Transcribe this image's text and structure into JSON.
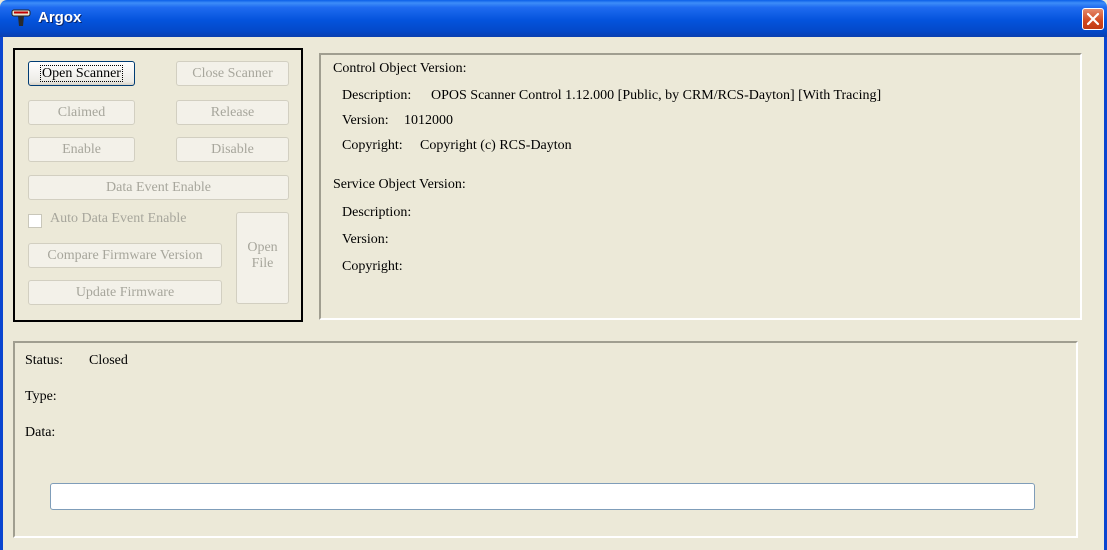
{
  "window": {
    "title": "Argox",
    "app_icon": "scanner-app-icon",
    "close_icon": "close-icon"
  },
  "controls": {
    "open_scanner": "Open Scanner",
    "close_scanner": "Close Scanner",
    "claimed": "Claimed",
    "release": "Release",
    "enable": "Enable",
    "disable": "Disable",
    "data_event_enable": "Data Event Enable",
    "auto_data_event_enable": "Auto Data Event Enable",
    "compare_firmware_version": "Compare Firmware Version",
    "open_file": "Open File",
    "update_firmware": "Update Firmware"
  },
  "control_object": {
    "heading": "Control Object Version:",
    "description_label": "Description:",
    "description_value": "OPOS Scanner Control 1.12.000 [Public, by CRM/RCS-Dayton] [With Tracing]",
    "version_label": "Version:",
    "version_value": "1012000",
    "copyright_label": "Copyright:",
    "copyright_value": "Copyright (c) RCS-Dayton"
  },
  "service_object": {
    "heading": "Service Object Version:",
    "description_label": "Description:",
    "version_label": "Version:",
    "copyright_label": "Copyright:"
  },
  "status": {
    "status_label": "Status:",
    "status_value": "Closed",
    "type_label": "Type:",
    "data_label": "Data:",
    "input_value": ""
  },
  "colors": {
    "title_bar": "#0453DC",
    "window_bg": "#ECE9D8",
    "close_button": "#D1471E"
  }
}
